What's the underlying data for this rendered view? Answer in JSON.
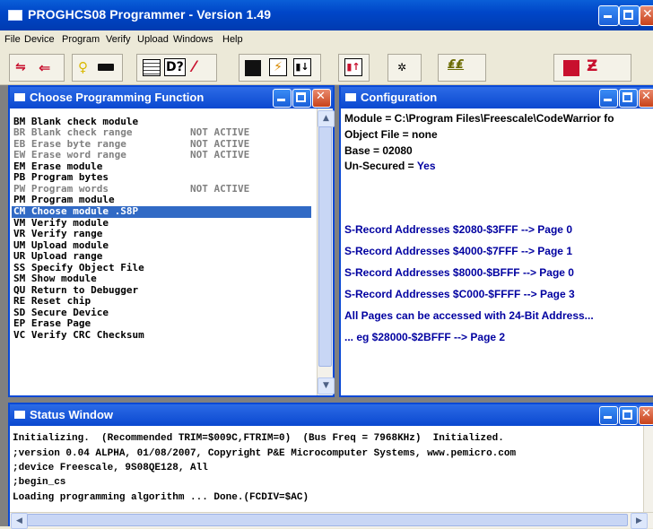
{
  "window": {
    "title": "PROGHCS08 Programmer - Version 1.49"
  },
  "menu": [
    "File",
    "Device",
    "Program",
    "Verify",
    "Upload",
    "Windows",
    "Help"
  ],
  "toolbar": {
    "buttons": [
      "connect-icon",
      "exit-icon",
      "bulb-icon",
      "chip-icon",
      "module-icon",
      "help-icon",
      "erase-icon",
      "save-icon",
      "program-icon",
      "verify-icon",
      "upload-icon",
      "bug-icon",
      "script-icon",
      "save-red-icon",
      "program-red-icon"
    ]
  },
  "function_window": {
    "title": "Choose Programming Function",
    "items": [
      {
        "code": "BM",
        "text": "Blank check module",
        "status": "",
        "active": true
      },
      {
        "code": "BR",
        "text": "Blank check range",
        "status": "NOT ACTIVE",
        "active": false
      },
      {
        "code": "EB",
        "text": "Erase byte range",
        "status": "NOT ACTIVE",
        "active": false
      },
      {
        "code": "EW",
        "text": "Erase word range",
        "status": "NOT ACTIVE",
        "active": false
      },
      {
        "code": "EM",
        "text": "Erase module",
        "status": "",
        "active": true
      },
      {
        "code": "PB",
        "text": "Program bytes",
        "status": "",
        "active": true
      },
      {
        "code": "PW",
        "text": "Program words",
        "status": "NOT ACTIVE",
        "active": false
      },
      {
        "code": "PM",
        "text": "Program module",
        "status": "",
        "active": true
      },
      {
        "code": "CM",
        "text": "Choose module .S8P",
        "status": "",
        "active": true,
        "selected": true
      },
      {
        "code": "VM",
        "text": "Verify module",
        "status": "",
        "active": true
      },
      {
        "code": "VR",
        "text": "Verify range",
        "status": "",
        "active": true
      },
      {
        "code": "UM",
        "text": "Upload module",
        "status": "",
        "active": true
      },
      {
        "code": "UR",
        "text": "Upload range",
        "status": "",
        "active": true
      },
      {
        "code": "SS",
        "text": "Specify Object File",
        "status": "",
        "active": true
      },
      {
        "code": "SM",
        "text": "Show module",
        "status": "",
        "active": true
      },
      {
        "code": "QU",
        "text": "Return to Debugger",
        "status": "",
        "active": true
      },
      {
        "code": "RE",
        "text": "Reset chip",
        "status": "",
        "active": true
      },
      {
        "code": "SD",
        "text": "Secure Device",
        "status": "",
        "active": true
      },
      {
        "code": "EP",
        "text": "Erase Page",
        "status": "",
        "active": true
      },
      {
        "code": "VC",
        "text": "Verify CRC Checksum",
        "status": "",
        "active": true
      }
    ]
  },
  "config_window": {
    "title": "Configuration",
    "module": "Module = C:\\Program Files\\Freescale\\CodeWarrior fo",
    "object_file": "Object File = none",
    "base": "Base = 02080",
    "unsecured_label": "Un-Secured = ",
    "unsecured_value": "Yes",
    "pages": [
      "S-Record Addresses $2080-$3FFF --> Page 0",
      "S-Record Addresses $4000-$7FFF --> Page 1",
      "S-Record Addresses $8000-$BFFF --> Page 0",
      "S-Record Addresses $C000-$FFFF --> Page 3",
      "All Pages can be accessed with 24-Bit Address...",
      "... eg $28000-$2BFFF --> Page 2"
    ],
    "accent_color": "#0000a0"
  },
  "status_window": {
    "title": "Status Window",
    "lines": [
      "Initializing.  (Recommended TRIM=$009C,FTRIM=0)  (Bus Freq = 7968KHz)  Initialized.",
      ";version 0.04 ALPHA, 01/08/2007, Copyright P&E Microcomputer Systems, www.pemicro.com",
      ";device Freescale, 9S08QE128, All",
      ";begin_cs",
      "Loading programming algorithm ... Done.(FCDIV=$AC)"
    ]
  },
  "colors": {
    "titlebar": "#0a5fd8",
    "selection": "#316ac5",
    "dim_text": "#808080"
  }
}
